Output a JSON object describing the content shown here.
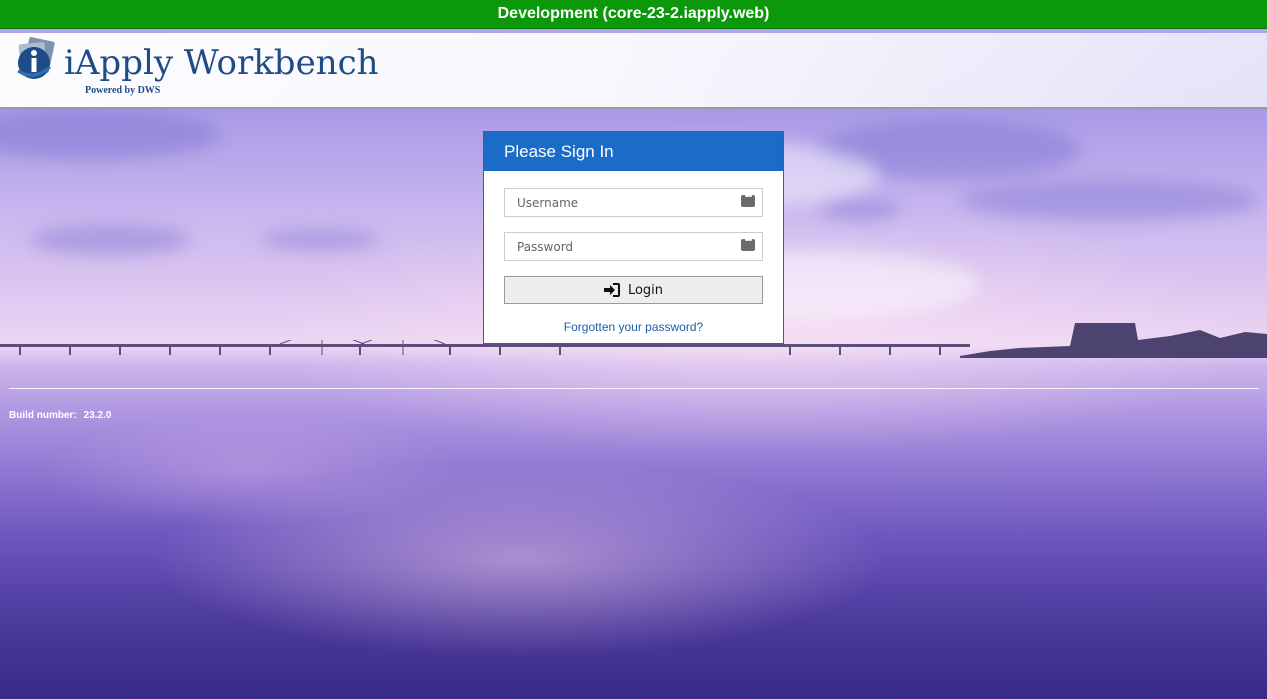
{
  "environment_banner": {
    "text": "Development (core-23-2.iapply.web)",
    "color": "#0b990b"
  },
  "header": {
    "logo_title": "iApply Workbench",
    "logo_subtitle": "Powered by DWS",
    "logo_icon": "iapply-logo-icon"
  },
  "login": {
    "title": "Please Sign In",
    "username": {
      "placeholder": "Username",
      "value": "",
      "icon": "credential-dots-icon"
    },
    "password": {
      "placeholder": "Password",
      "value": "",
      "icon": "credential-dots-icon"
    },
    "login_button": {
      "label": "Login",
      "icon": "sign-in-icon"
    },
    "forgot_link": "Forgotten your password?",
    "accent_color": "#1b6cc9"
  },
  "footer": {
    "build_label": "Build number:",
    "build_value": "23.2.0"
  }
}
